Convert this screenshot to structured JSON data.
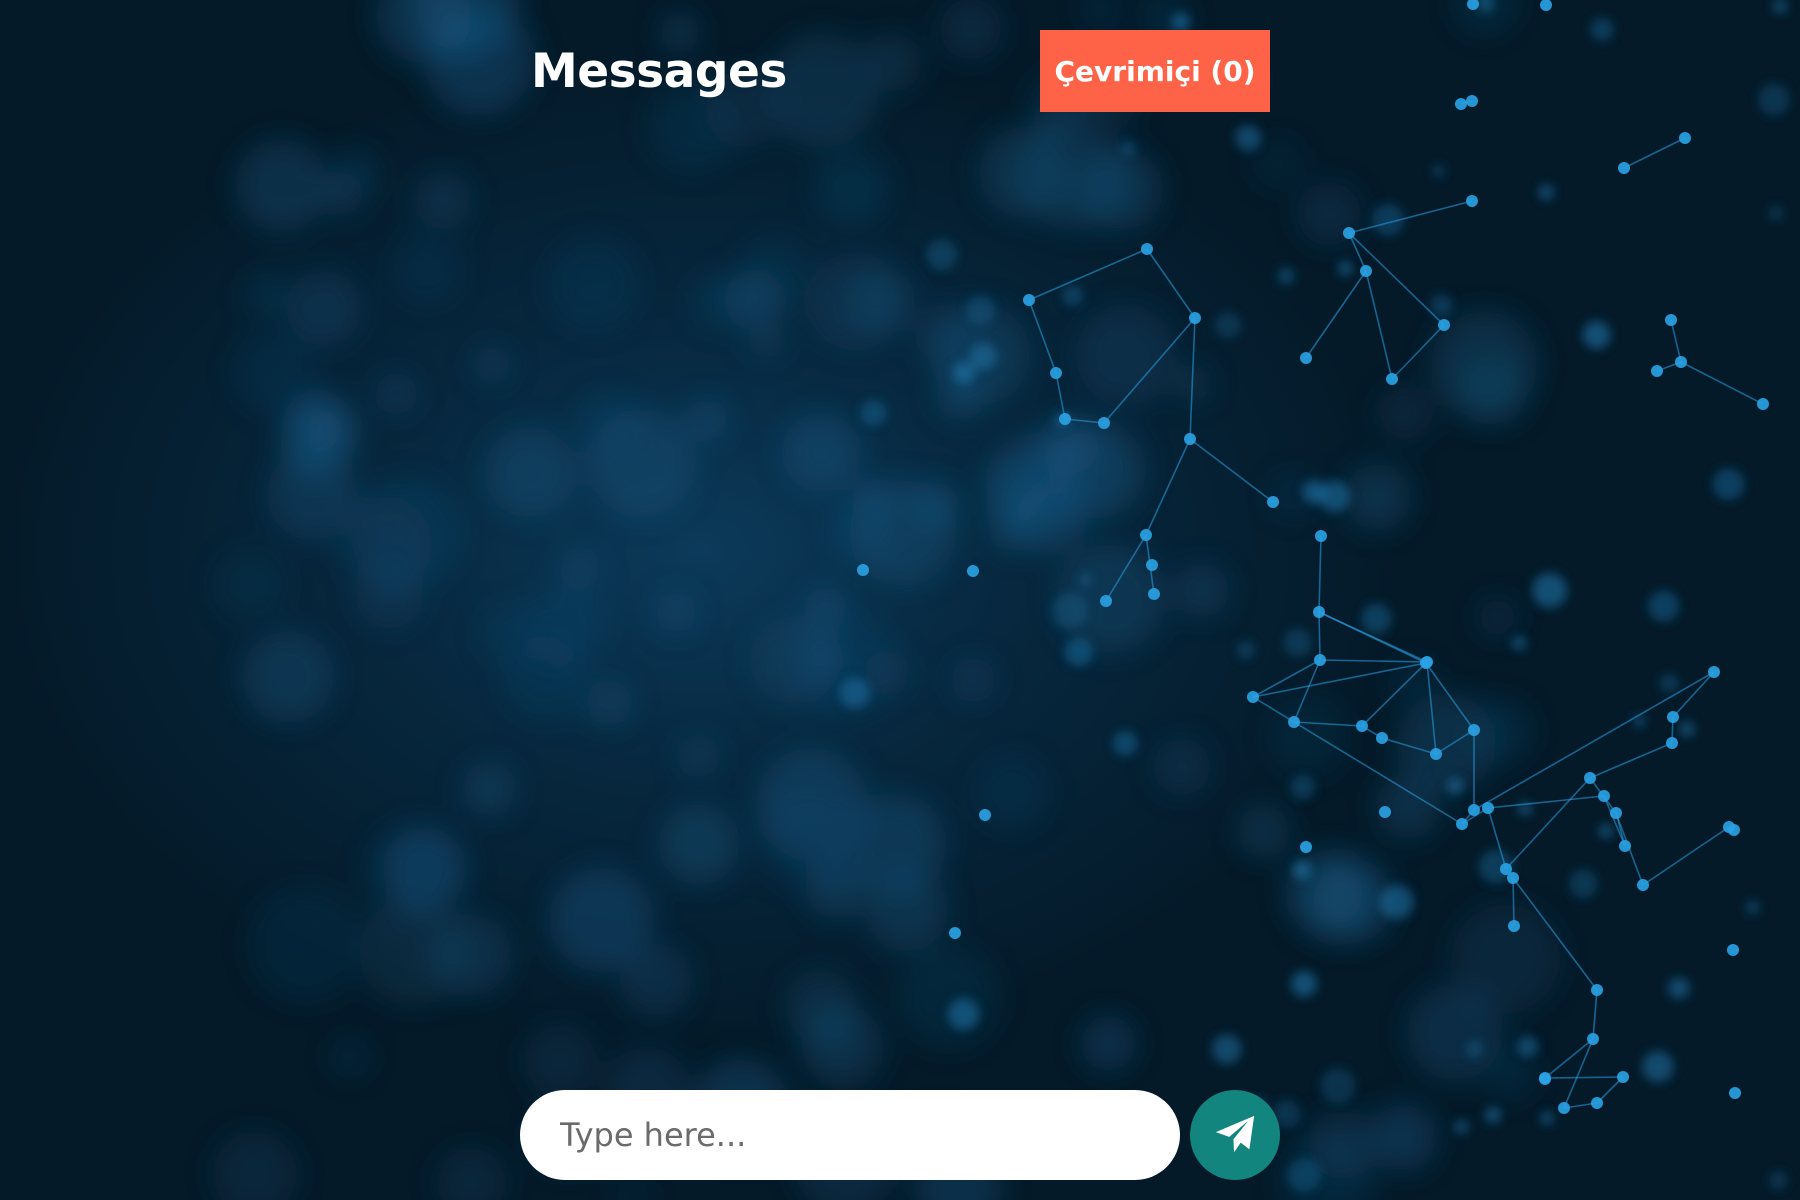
{
  "header": {
    "title": "Messages",
    "online_button_label": "Çevrimiçi (0)"
  },
  "composer": {
    "placeholder": "Type here...",
    "value": "",
    "send_icon": "paper-plane-icon"
  },
  "colors": {
    "background": "#041a29",
    "online_button": "#ff6347",
    "send_button": "#13857f",
    "network_nodes": "#2aa3e6"
  },
  "background": {
    "description_icon": "network-particles-image"
  }
}
